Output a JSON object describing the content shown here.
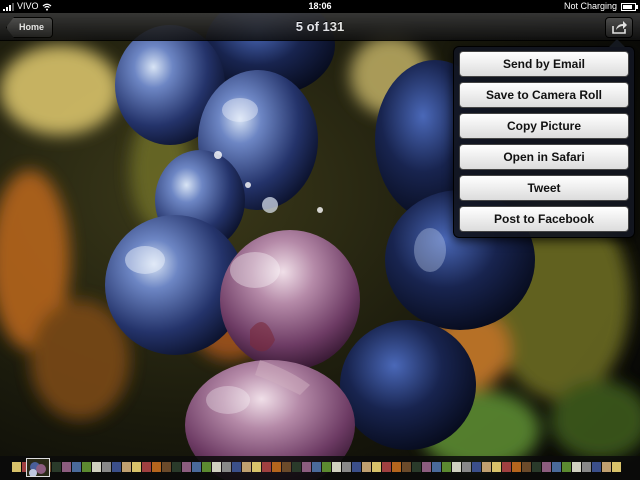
{
  "status_bar": {
    "carrier": "VIVO",
    "time": "18:06",
    "charging": "Not Charging",
    "signal_icon": "signal-bars-icon",
    "wifi_icon": "wifi-icon",
    "battery_icon": "battery-icon",
    "battery_level": 0.85
  },
  "nav_bar": {
    "back_label": "Home",
    "title": "5 of 131",
    "share_icon": "share-icon"
  },
  "share_menu": {
    "items": [
      "Send by Email",
      "Save to Camera Roll",
      "Copy Picture",
      "Open in Safari",
      "Tweet",
      "Post to Facebook"
    ]
  },
  "photo": {
    "subject": "grape-cluster-photo",
    "colors": {
      "grape_blue": "#3b4f8a",
      "grape_purple": "#8c5d7f",
      "leaf_orange": "#b5651d",
      "leaf_yellow": "#d8c26a",
      "background": "#141208"
    }
  },
  "filmstrip": {
    "thumbnail_count": 131,
    "current_index": 5
  }
}
